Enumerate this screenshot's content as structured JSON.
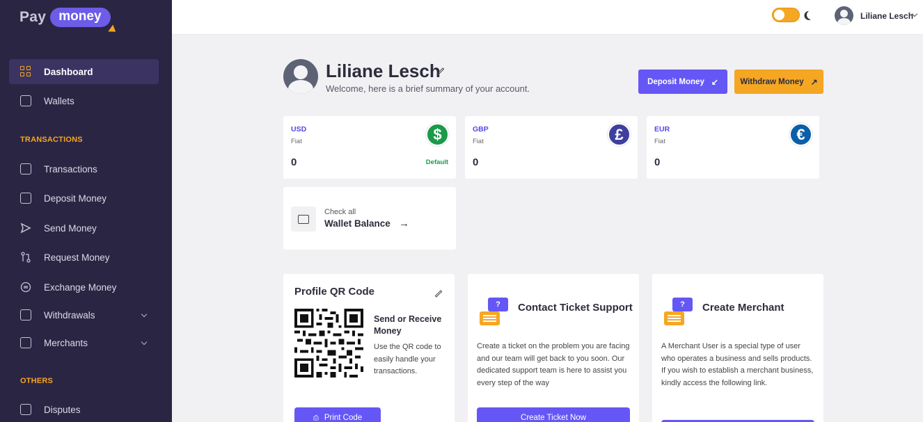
{
  "brand": {
    "pay": "Pay",
    "money": "money"
  },
  "sidebar": {
    "items": [
      {
        "label": "Dashboard",
        "icon": "dashboard-icon"
      },
      {
        "label": "Wallets",
        "icon": "wallet-icon"
      },
      {
        "label": "Transactions",
        "icon": "transactions-icon"
      },
      {
        "label": "Deposit Money",
        "icon": "deposit-icon"
      },
      {
        "label": "Send Money",
        "icon": "send-icon"
      },
      {
        "label": "Request Money",
        "icon": "request-icon"
      },
      {
        "label": "Exchange Money",
        "icon": "exchange-icon"
      },
      {
        "label": "Withdrawals",
        "icon": "withdrawals-icon"
      },
      {
        "label": "Merchants",
        "icon": "merchants-icon"
      },
      {
        "label": "Disputes",
        "icon": "disputes-icon"
      }
    ],
    "sections": {
      "transactions": "TRANSACTIONS",
      "others": "OTHERS"
    }
  },
  "topbar": {
    "user_name": "Liliane Lesch"
  },
  "header": {
    "name": "Liliane Lesch",
    "welcome": "Welcome, here is a brief summary of your account.",
    "deposit_label": "Deposit Money",
    "withdraw_label": "Withdraw Money"
  },
  "currencies": [
    {
      "code": "USD",
      "type": "Fiat",
      "balance": "0",
      "symbol": "$",
      "color": "#1a9a4a",
      "default": "Default"
    },
    {
      "code": "GBP",
      "type": "Fiat",
      "balance": "0",
      "symbol": "£",
      "color": "#3f3f9e"
    },
    {
      "code": "EUR",
      "type": "Fiat",
      "balance": "0",
      "symbol": "€",
      "color": "#0a5fa8"
    }
  ],
  "wallet_balance": {
    "check_all": "Check all",
    "label": "Wallet Balance"
  },
  "qr_card": {
    "title": "Profile QR Code",
    "subtitle": "Send or Receive Money",
    "desc": "Use the QR code to easily handle your transactions.",
    "button": "Print Code"
  },
  "ticket_card": {
    "title": "Contact Ticket Support",
    "desc": "Create a ticket on the problem you are facing and our team will get back to you soon. Our dedicated support team is here to assist you every step of the way",
    "button": "Create Ticket Now"
  },
  "merchant_card": {
    "title": "Create Merchant",
    "desc": "A Merchant User is a special type of user who operates a business and sells products. If you wish to establish a merchant business, kindly access the following link."
  }
}
